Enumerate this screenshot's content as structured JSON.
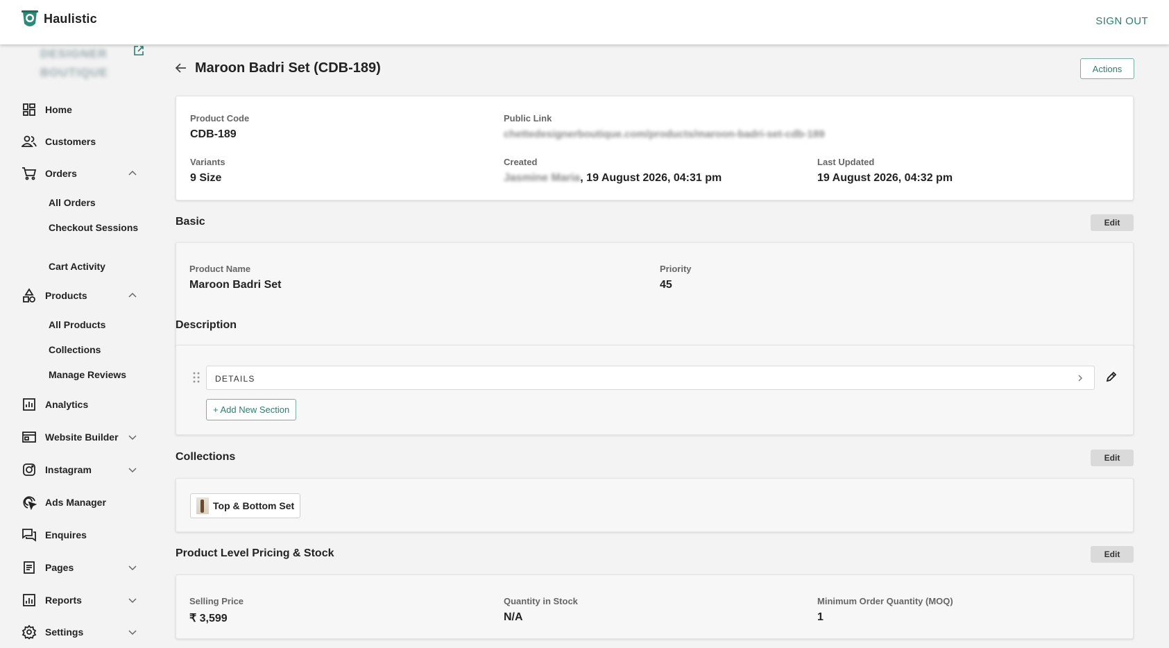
{
  "app": {
    "brand": "Haulistic",
    "sign_out": "SIGN OUT",
    "store_name_line1": "DESIGNER",
    "store_name_line2": "BOUTIQUE"
  },
  "sidebar": {
    "home": "Home",
    "customers": "Customers",
    "orders": "Orders",
    "orders_sub": [
      "All Orders",
      "Checkout Sessions",
      "Cart Activity"
    ],
    "products": "Products",
    "products_sub": [
      "All Products",
      "Collections",
      "Manage Reviews"
    ],
    "analytics": "Analytics",
    "website_builder": "Website Builder",
    "instagram": "Instagram",
    "ads_manager": "Ads Manager",
    "enquires": "Enquires",
    "pages": "Pages",
    "reports": "Reports",
    "settings": "Settings"
  },
  "header": {
    "title": "Maroon Badri Set (CDB-189)",
    "actions": "Actions"
  },
  "summary": {
    "product_code_label": "Product Code",
    "product_code": "CDB-189",
    "public_link_label": "Public Link",
    "public_link": "chettedesignerboutique.com/products/maroon-badri-set-cdb-189",
    "variants_label": "Variants",
    "variants": "9 Size",
    "created_label": "Created",
    "created_by": "Jasmine Maria",
    "created_at": ", 19 August 2026, 04:31 pm",
    "updated_label": "Last Updated",
    "updated_at": "19 August 2026, 04:32 pm"
  },
  "basic": {
    "title": "Basic",
    "edit": "Edit",
    "name_label": "Product Name",
    "name": "Maroon Badri Set",
    "priority_label": "Priority",
    "priority": "45"
  },
  "description": {
    "title": "Description",
    "section": "DETAILS",
    "add": "+ Add New Section"
  },
  "collections": {
    "title": "Collections",
    "edit": "Edit",
    "chip": "Top & Bottom Set"
  },
  "pricing": {
    "title": "Product Level Pricing & Stock",
    "edit": "Edit",
    "price_label": "Selling Price",
    "price": "₹ 3,599",
    "stock_label": "Quantity in Stock",
    "stock": "N/A",
    "moq_label": "Minimum Order Quantity (MOQ)",
    "moq": "1"
  },
  "colors": {
    "accent": "#2e7d6e",
    "sidebar_bg": "#f3f3f3",
    "edit_bg": "#dadada"
  }
}
